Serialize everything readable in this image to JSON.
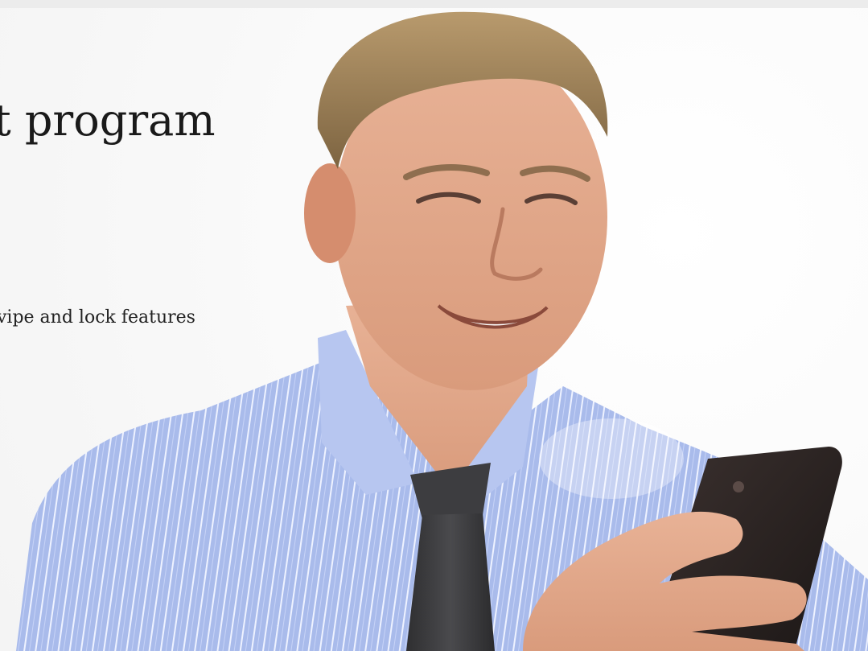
{
  "hero": {
    "headline": "t program",
    "feature_line": "vipe and lock features"
  },
  "colors": {
    "background": "#f7f7f7",
    "text": "#1a1a1a",
    "shirt": "#a8b9ea",
    "tie": "#3b3b3d",
    "phone": "#2a2322"
  },
  "icons": {
    "phone": "smartphone-icon"
  }
}
